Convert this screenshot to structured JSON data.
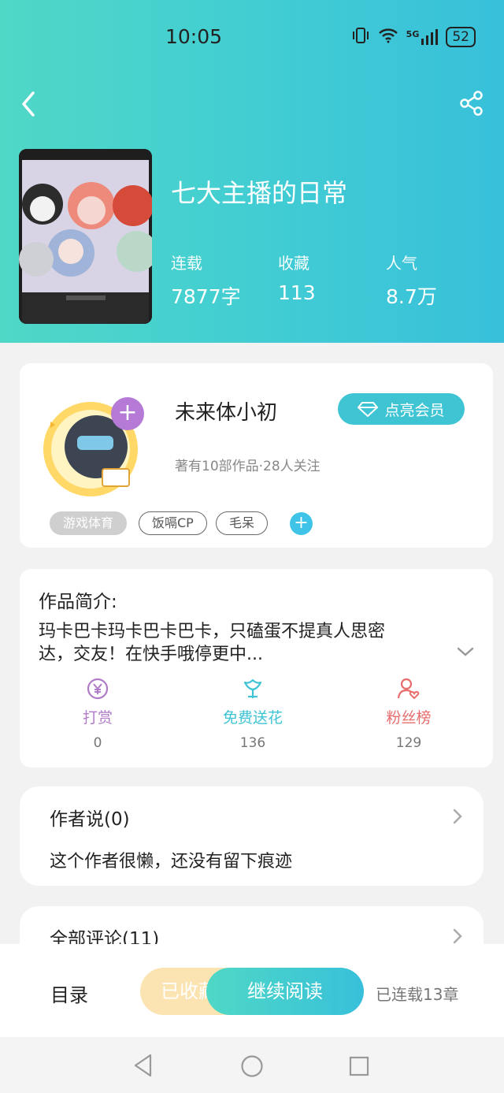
{
  "status": {
    "time": "10:05",
    "network": "5G",
    "battery": "52"
  },
  "book": {
    "title": "七大主播的日常",
    "stats": [
      {
        "label": "连载",
        "value": "7877字"
      },
      {
        "label": "收藏",
        "value": "113"
      },
      {
        "label": "人气",
        "value": "8.7万"
      }
    ]
  },
  "author": {
    "name": "未来体小初",
    "meta": "著有10部作品·28人关注",
    "vip_label": "点亮会员",
    "tags": [
      "游戏体育",
      "饭嗝CP",
      "毛呆"
    ]
  },
  "intro": {
    "heading": "作品简介:",
    "line1": "玛卡巴卡玛卡巴卡巴卡，只磕蛋不提真人思密",
    "line2": "达，交友！在快手哦停更中..."
  },
  "actions": [
    {
      "label": "打赏",
      "count": "0",
      "color": "#b07cc8"
    },
    {
      "label": "免费送花",
      "count": "136",
      "color": "#3fc4d4"
    },
    {
      "label": "粉丝榜",
      "count": "129",
      "color": "#e86c6c"
    }
  ],
  "author_says": {
    "title": "作者说(0)",
    "text": "这个作者很懒，还没有留下痕迹"
  },
  "comments": {
    "title": "全部评论(11)"
  },
  "bottom": {
    "catalog": "目录",
    "collected": "已收藏",
    "continue": "继续阅读",
    "chapters": "已连载13章"
  }
}
